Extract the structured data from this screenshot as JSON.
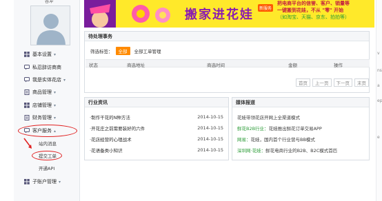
{
  "user": {
    "name": "谷冲"
  },
  "sidebar": {
    "items": [
      {
        "label": "基本设置",
        "icon": "grid-icon"
      },
      {
        "label": "私忍辞访商商",
        "icon": "chat-icon"
      },
      {
        "label": "我是实体花店",
        "icon": "chat-icon"
      },
      {
        "label": "商品管理",
        "icon": "doc-icon"
      },
      {
        "label": "店铺管理",
        "icon": "grid-icon"
      },
      {
        "label": "财务管理",
        "icon": "doc-icon"
      },
      {
        "label": "客户服务",
        "icon": "chat-icon"
      }
    ],
    "sub_items": [
      "站内消息",
      "提交工单",
      "开通API"
    ],
    "last_item": {
      "label": "子账户管理",
      "icon": "grid-icon"
    }
  },
  "banner": {
    "main": "搬家进花娃",
    "badge": "新服务",
    "line1": "把电商平台的信誉、客户、销量等",
    "line2": "一键搬到花娃，不从 \"零\" 开始",
    "line3": "（如淘宝、天猫、京东、拍拍等）"
  },
  "pending": {
    "title": "待处理事务",
    "filter_label": "筛选标签：",
    "tags": [
      "全部",
      "全部工单管理"
    ],
    "columns": [
      "状态",
      "商选地址",
      "商选时间",
      "金额",
      "操作"
    ],
    "pager": [
      "首页",
      "上一页",
      "下一页",
      "末页"
    ]
  },
  "industry": {
    "title": "行业资讯",
    "rows": [
      {
        "title": "·制作干花的N种方法",
        "date": "2014-10-15"
      },
      {
        "title": "·开花庄之前需要装好的六件",
        "date": "2014-10-15"
      },
      {
        "title": "·花店经营的心理战术",
        "date": "2014-10-15"
      },
      {
        "title": "·花语备类小知识",
        "date": "2014-10-15"
      }
    ]
  },
  "news": {
    "title": "媒体报道",
    "rows": [
      {
        "lead": "",
        "text": "花娃带领花店开网上全渠道模式"
      },
      {
        "lead": "鲜花B2B行业：",
        "text": "花娃推出鲜花订单交易APP"
      },
      {
        "lead": "网易：",
        "text": "花娃，国内首个行业营与BB模式"
      },
      {
        "lead": "深圳网·花娃：",
        "text": "鲜花电商行业的B2B、B2C模式首匹"
      }
    ]
  },
  "right_edge": {
    "labels": [
      "v",
      "ns",
      "a",
      "ep",
      "e"
    ]
  }
}
